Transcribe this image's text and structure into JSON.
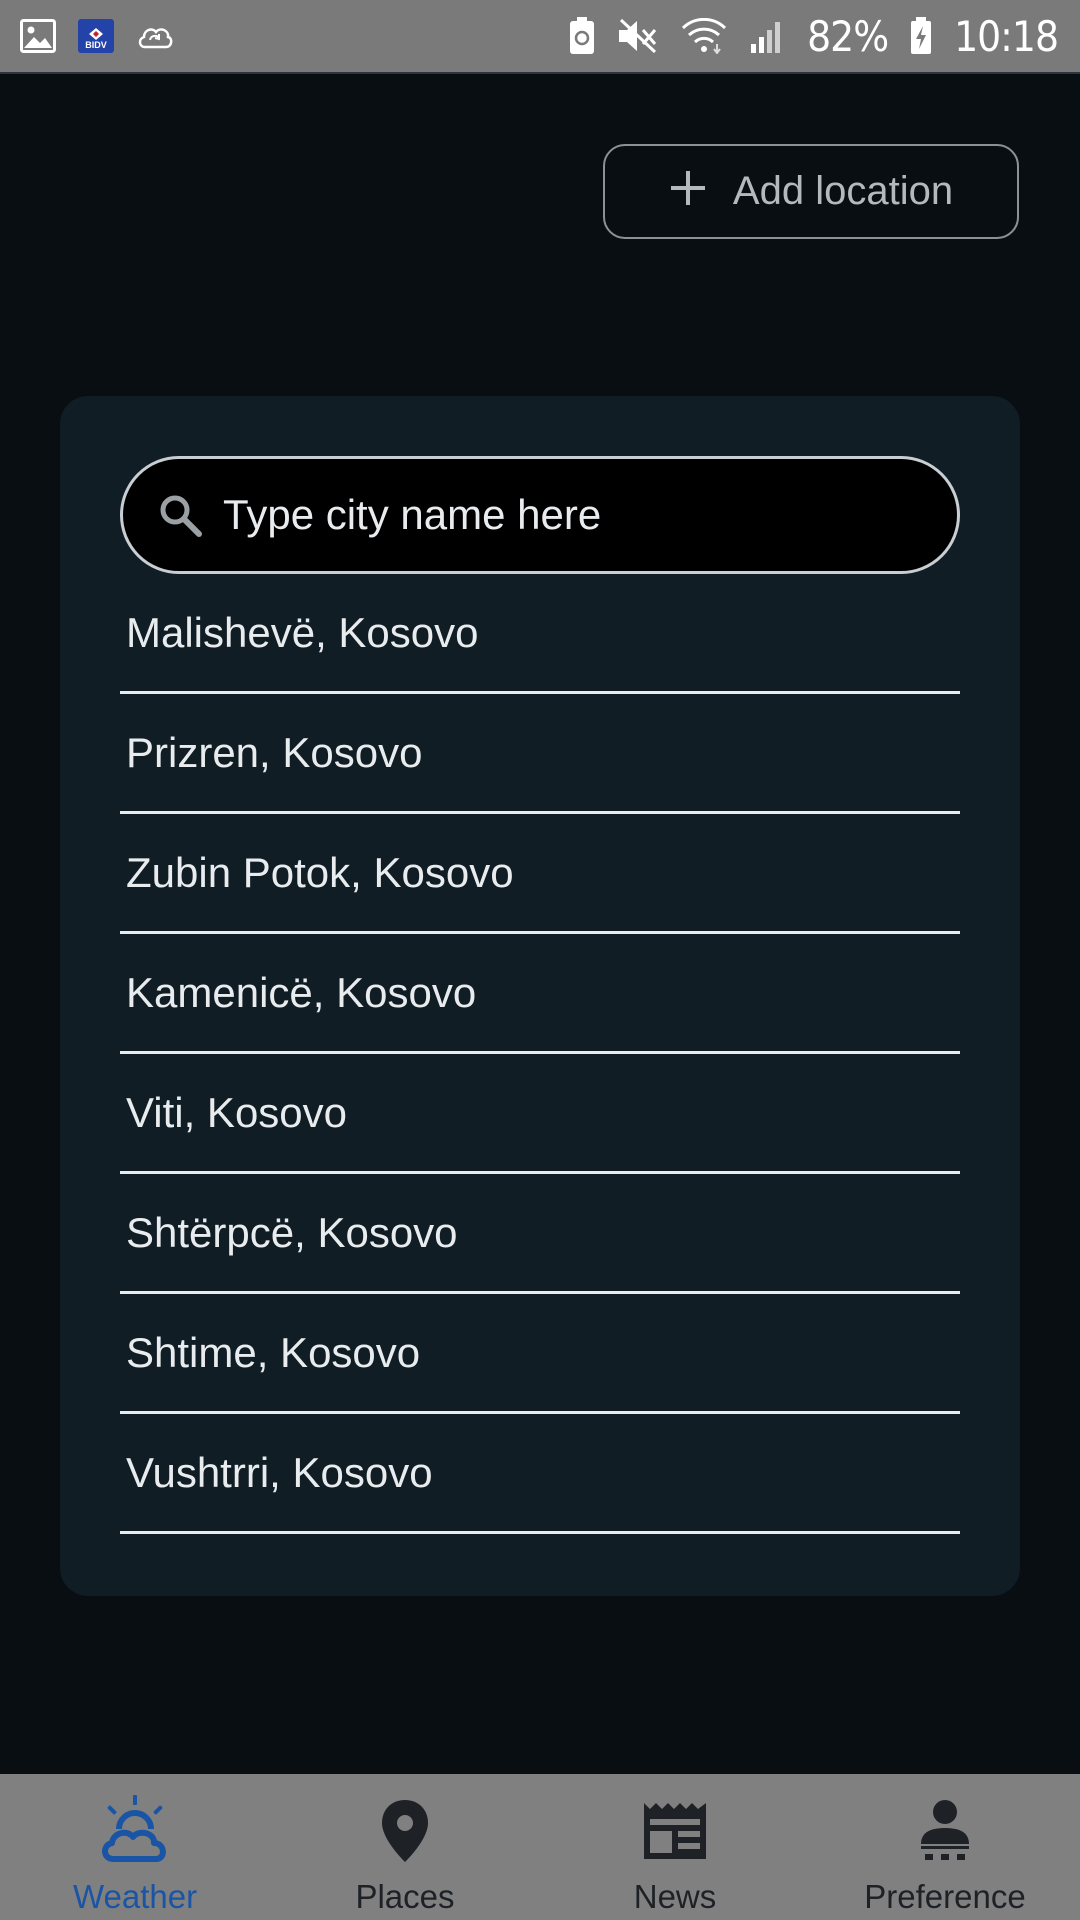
{
  "status_bar": {
    "left_icons": [
      "gallery-icon",
      "bidv-app-icon",
      "cloud-sync-icon"
    ],
    "app_badge_text": "BIDV",
    "right_icons": [
      "battery-saver-icon",
      "mute-icon",
      "wifi-icon",
      "signal-icon"
    ],
    "battery": "82%",
    "time": "10:18"
  },
  "header": {
    "add_location_label": "Add location"
  },
  "search": {
    "placeholder": "Type city name here"
  },
  "cities": [
    "Malishevë, Kosovo",
    "Prizren, Kosovo",
    "Zubin Potok, Kosovo",
    "Kamenicë, Kosovo",
    "Viti, Kosovo",
    "Shtërpcë, Kosovo",
    "Shtime, Kosovo",
    "Vushtrri, Kosovo"
  ],
  "nav": {
    "items": [
      {
        "label": "Weather",
        "icon": "weather-icon",
        "active": true
      },
      {
        "label": "Places",
        "icon": "location-pin-icon",
        "active": false
      },
      {
        "label": "News",
        "icon": "newspaper-icon",
        "active": false
      },
      {
        "label": "Preference",
        "icon": "person-icon",
        "active": false
      }
    ]
  },
  "colors": {
    "background": "#080e12",
    "card": "#111d24",
    "nav_active": "#1a55a5",
    "nav_bar": "#808080",
    "status_bar": "#7a7a7a"
  }
}
